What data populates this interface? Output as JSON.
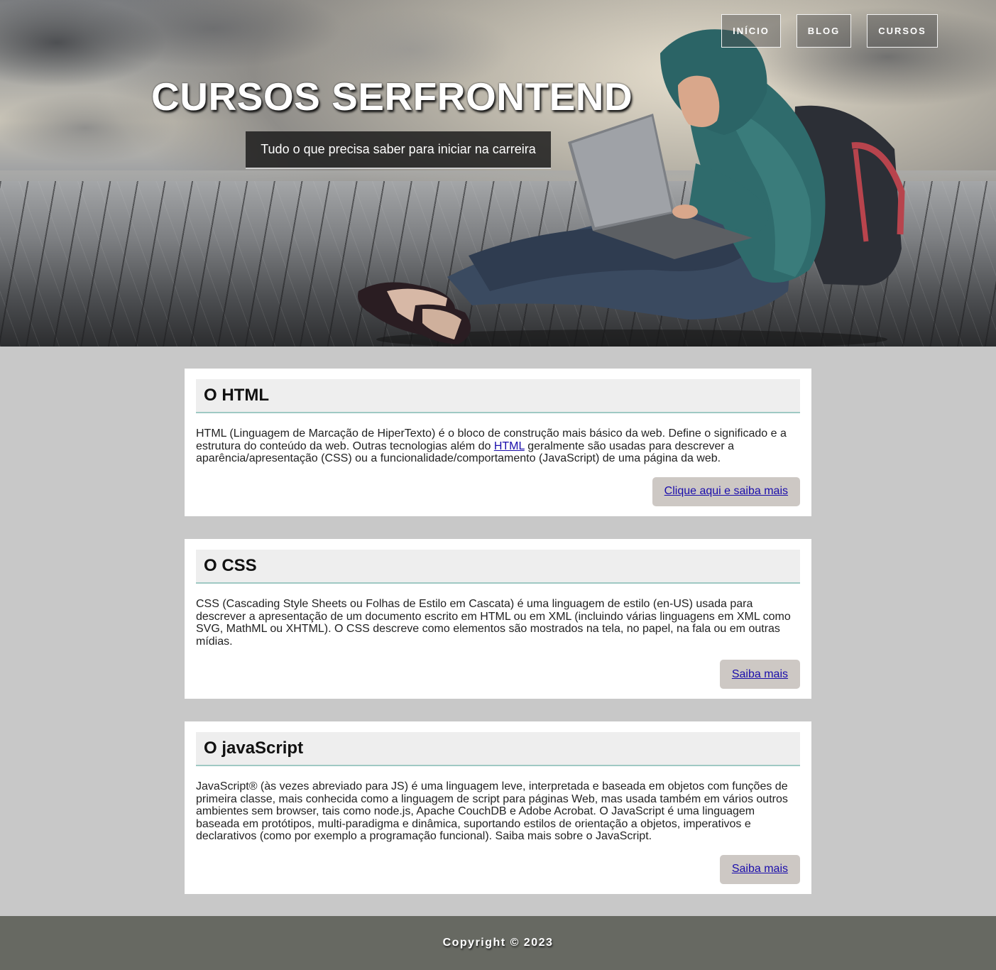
{
  "nav": {
    "items": [
      "INÍCIO",
      "BLOG",
      "CURSOS"
    ]
  },
  "hero": {
    "title": "CURSOS SERFRONTEND",
    "subtitle": "Tudo o que precisa saber para iniciar na carreira"
  },
  "cards": [
    {
      "title": "O HTML",
      "text_before": "HTML (Linguagem de Marcação de HiperTexto) é o bloco de construção mais básico da web. Define o significado e a estrutura do conteúdo da web. Outras tecnologias além do ",
      "link": "HTML",
      "text_after": " geralmente são usadas para descrever a aparência/apresentação (CSS) ou a funcionalidade/comportamento (JavaScript) de uma página da web.",
      "button": "Clique aqui e saiba mais"
    },
    {
      "title": "O CSS",
      "text": "CSS (Cascading Style Sheets ou Folhas de Estilo em Cascata) é uma linguagem de estilo (en-US) usada para descrever a apresentação de um documento escrito em HTML ou em XML (incluindo várias linguagens em XML como SVG, MathML ou XHTML). O CSS descreve como elementos são mostrados na tela, no papel, na fala ou em outras mídias.",
      "button": "Saiba mais"
    },
    {
      "title": "O javaScript",
      "text": "JavaScript® (às vezes abreviado para JS) é uma linguagem leve, interpretada e baseada em objetos com funções de primeira classe, mais conhecida como a linguagem de script para páginas Web, mas usada também em vários outros ambientes sem browser, tais como node.js, Apache CouchDB e Adobe Acrobat. O JavaScript é uma linguagem baseada em protótipos, multi-paradigma e dinâmica, suportando estilos de orientação a objetos, imperativos e declarativos (como por exemplo a programação funcional). Saiba mais sobre o JavaScript.",
      "button": "Saiba mais"
    }
  ],
  "footer": {
    "copyright": "Copyright © 2023"
  },
  "colors": {
    "page_bg": "#c8c8c8",
    "card_head_bg": "#eeeeee",
    "card_head_border": "#9fc9c3",
    "button_bg": "#cdc8c4",
    "link": "#1a0dab",
    "footer_bg": "#676962"
  }
}
